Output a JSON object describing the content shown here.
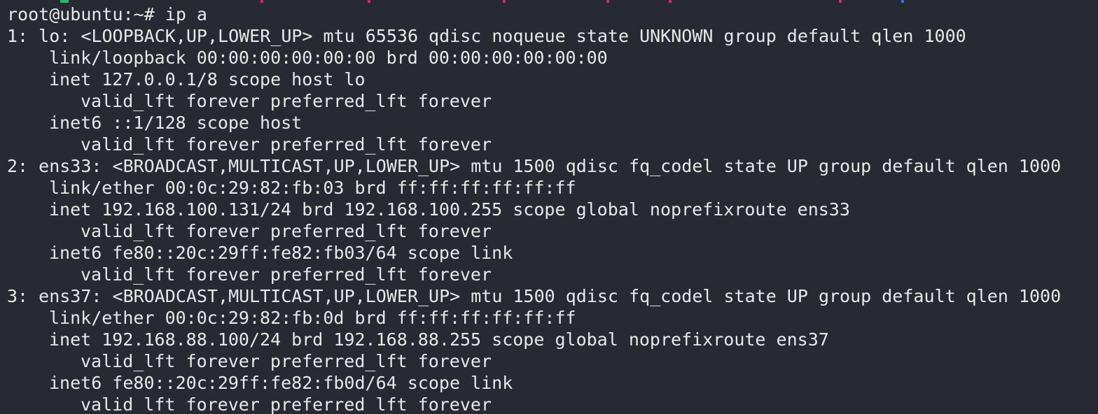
{
  "terminal": {
    "prompt": "root@ubuntu:~# ",
    "command": "ip a"
  },
  "interfaces": [
    {
      "header": "1: lo: <LOOPBACK,UP,LOWER_UP> mtu 65536 qdisc noqueue state UNKNOWN group default qlen 1000",
      "link": "link/loopback 00:00:00:00:00:00 brd 00:00:00:00:00:00",
      "inet": "inet 127.0.0.1/8 scope host lo",
      "inet_lft": "valid_lft forever preferred_lft forever",
      "inet6": "inet6 ::1/128 scope host",
      "inet6_lft": "valid_lft forever preferred_lft forever"
    },
    {
      "header": "2: ens33: <BROADCAST,MULTICAST,UP,LOWER_UP> mtu 1500 qdisc fq_codel state UP group default qlen 1000",
      "link": "link/ether 00:0c:29:82:fb:03 brd ff:ff:ff:ff:ff:ff",
      "inet": "inet 192.168.100.131/24 brd 192.168.100.255 scope global noprefixroute ens33",
      "inet_lft": "valid_lft forever preferred_lft forever",
      "inet6": "inet6 fe80::20c:29ff:fe82:fb03/64 scope link",
      "inet6_lft": "valid_lft forever preferred_lft forever"
    },
    {
      "header": "3: ens37: <BROADCAST,MULTICAST,UP,LOWER_UP> mtu 1500 qdisc fq_codel state UP group default qlen 1000",
      "link": "link/ether 00:0c:29:82:fb:0d brd ff:ff:ff:ff:ff:ff",
      "inet": "inet 192.168.88.100/24 brd 192.168.88.255 scope global noprefixroute ens37",
      "inet_lft": "valid_lft forever preferred_lft forever",
      "inet6": "inet6 fe80::20c:29ff:fe82:fb0d/64 scope link",
      "inet6_lft": "valid_lft forever preferred_lft forever"
    }
  ],
  "colors": {
    "background": "#272a33",
    "text": "#e8e8e8",
    "strip_green": "#1fbf6a",
    "strip_red": "#e0245e",
    "strip_blue": "#2f6df5"
  }
}
